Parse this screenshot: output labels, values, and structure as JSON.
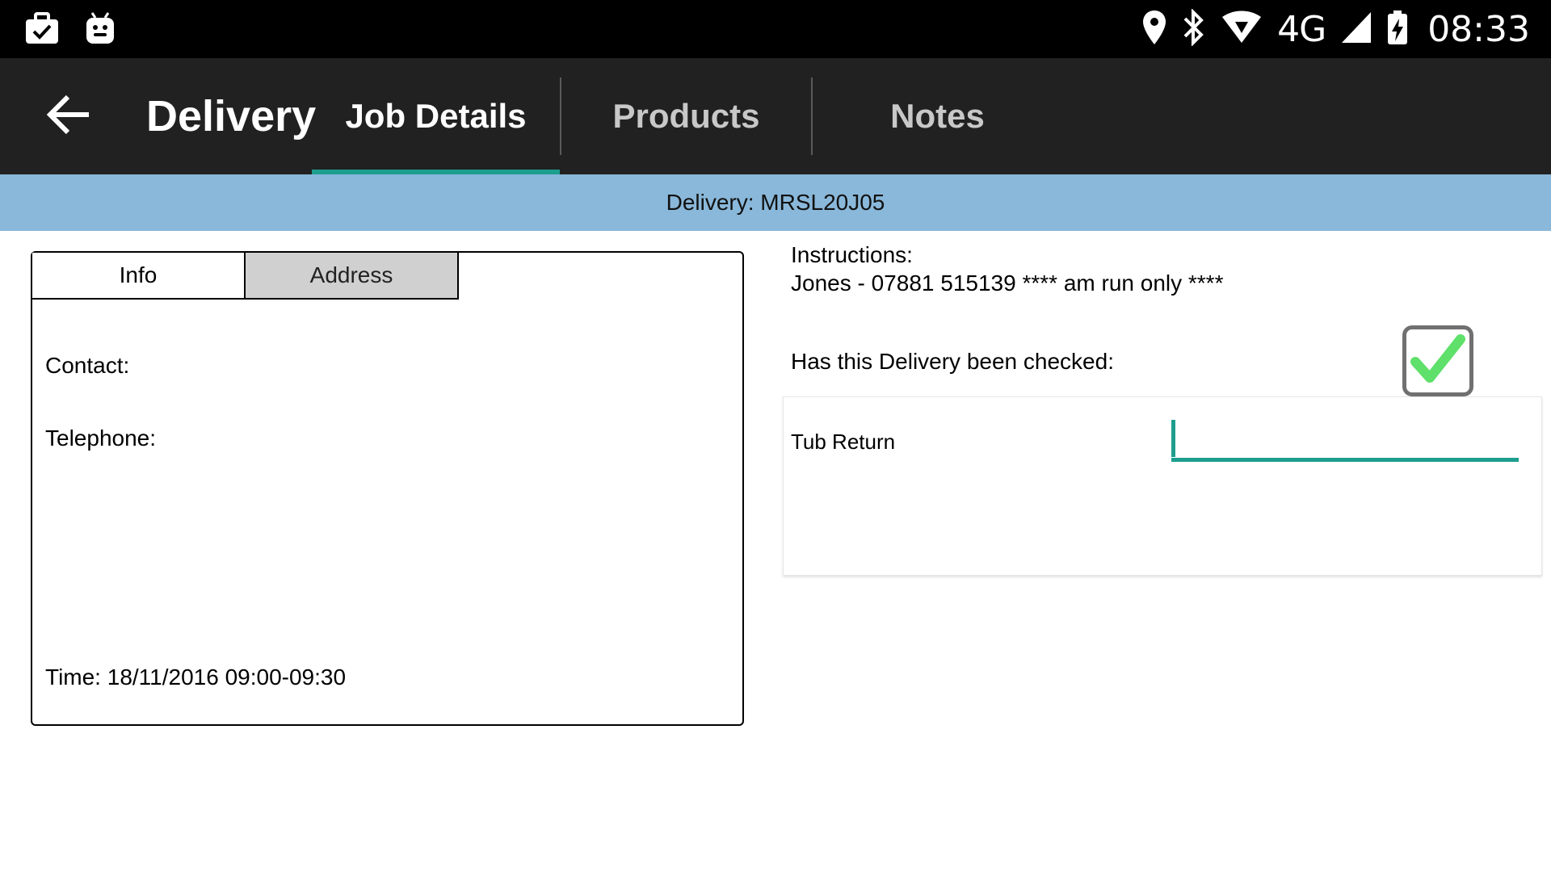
{
  "status_bar": {
    "network": "4G",
    "time": "08:33",
    "left_icons": [
      "briefcase-check-icon",
      "android-icon"
    ],
    "right_icons": [
      "location-pin-icon",
      "bluetooth-icon",
      "wifi-icon",
      "signal-icon",
      "battery-charging-icon"
    ]
  },
  "app_bar": {
    "title": "Delivery",
    "back_icon": "arrow-left-icon",
    "tabs": [
      {
        "label": "Job Details",
        "active": true
      },
      {
        "label": "Products",
        "active": false
      },
      {
        "label": "Notes",
        "active": false
      }
    ]
  },
  "banner": {
    "text": "Delivery: MRSL20J05"
  },
  "info_panel": {
    "tabs": [
      {
        "label": "Info",
        "selected": true
      },
      {
        "label": "Address",
        "selected": false
      }
    ],
    "contact_label": "Contact:",
    "telephone_label": "Telephone:",
    "time_text": "Time: 18/11/2016 09:00-09:30"
  },
  "instructions": {
    "label": "Instructions:",
    "text": "Jones - 07881 515139 **** am run only ****"
  },
  "delivery_check": {
    "label": "Has this Delivery been checked:",
    "checked": true
  },
  "tub_return": {
    "label": "Tub Return",
    "value": "",
    "placeholder": ""
  },
  "colors": {
    "accent": "#1e9e8e",
    "app_bar": "#212121",
    "banner": "#8ab8da",
    "check_mark": "#5ee06a"
  }
}
